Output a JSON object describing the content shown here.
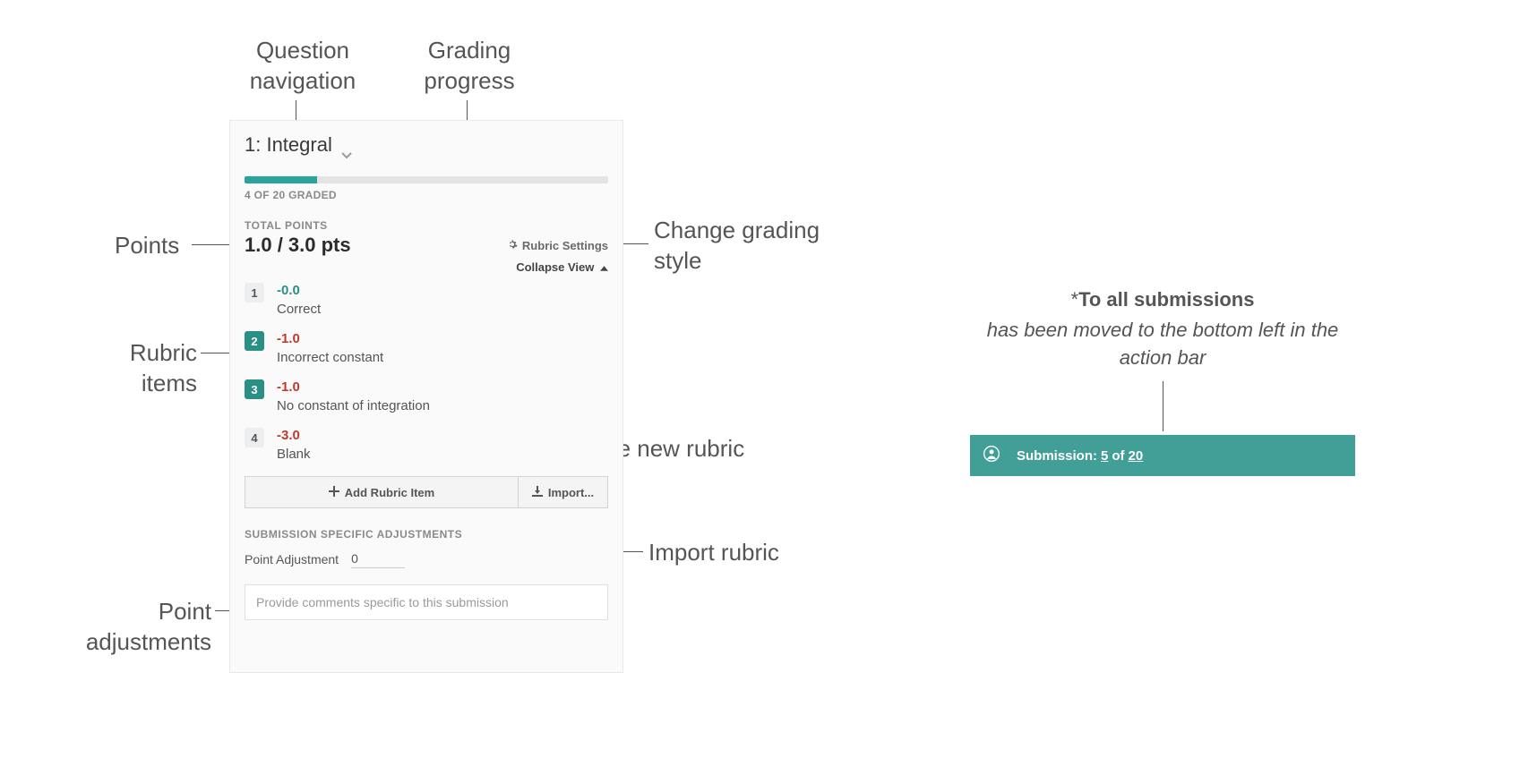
{
  "annotations": {
    "question_navigation": "Question navigation",
    "grading_progress": "Grading progress",
    "points": "Points",
    "rubric_items": "Rubric items",
    "point_adjustments": "Point adjustments",
    "change_grading_style": "Change grading style",
    "create_new_rubric_item": "Create new rubric item",
    "import_rubric": "Import rubric"
  },
  "panel": {
    "question_label": "1: Integral",
    "progress_text": "4 OF 20 GRADED",
    "progress_percent": 20,
    "total_points_label": "TOTAL POINTS",
    "points_value": "1.0 / 3.0 pts",
    "rubric_settings_label": "Rubric Settings",
    "collapse_view_label": "Collapse View",
    "rubric_items": [
      {
        "num": "1",
        "points": "-0.0",
        "desc": "Correct",
        "selected": false,
        "zero": true
      },
      {
        "num": "2",
        "points": "-1.0",
        "desc": "Incorrect constant",
        "selected": true,
        "zero": false
      },
      {
        "num": "3",
        "points": "-1.0",
        "desc": "No constant of integration",
        "selected": true,
        "zero": false
      },
      {
        "num": "4",
        "points": "-3.0",
        "desc": "Blank",
        "selected": false,
        "zero": false
      }
    ],
    "add_rubric_item_label": "Add Rubric Item",
    "import_label": "Import...",
    "ssa_label": "SUBMISSION SPECIFIC ADJUSTMENTS",
    "point_adjustment_label": "Point Adjustment",
    "point_adjustment_value": "0",
    "comment_placeholder": "Provide comments specific to this submission"
  },
  "note": {
    "line1_prefix": "*",
    "line1_bold": "To all submissions",
    "line2": "has been moved to the bottom left in the action bar"
  },
  "action_bar": {
    "prefix": "Submission:",
    "current": "5",
    "of": "of",
    "total": "20"
  }
}
